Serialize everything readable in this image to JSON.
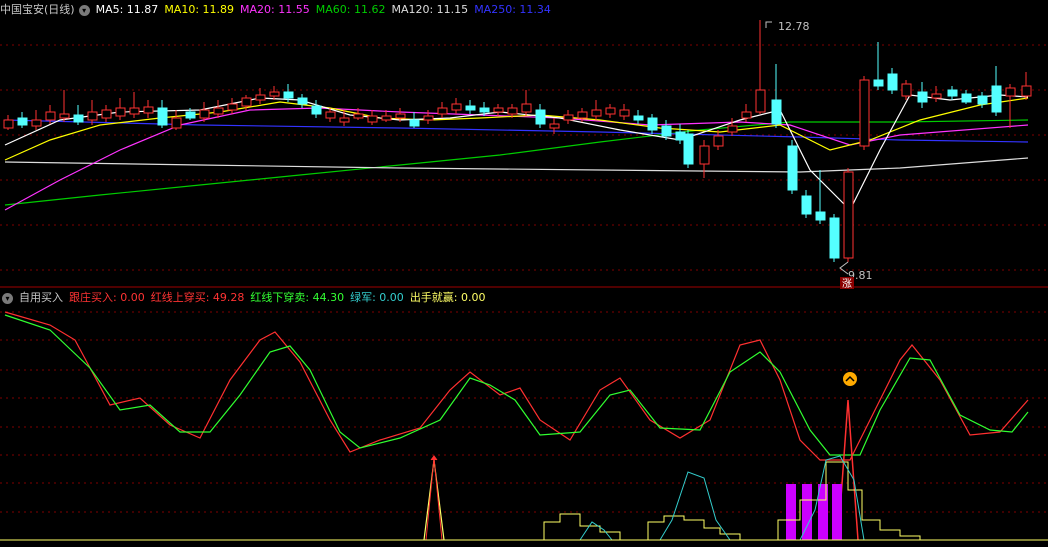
{
  "main_panel": {
    "title": "中国宝安(日线)",
    "ma": [
      {
        "label": "MA5: 11.87",
        "color": "#ffffff"
      },
      {
        "label": "MA10: 11.89",
        "color": "#ffff00"
      },
      {
        "label": "MA20: 11.55",
        "color": "#ff33ff"
      },
      {
        "label": "MA60: 11.62",
        "color": "#00cc00"
      },
      {
        "label": "MA120: 11.15",
        "color": "#dddddd"
      },
      {
        "label": "MA250: 11.34",
        "color": "#3333ff"
      }
    ],
    "high_label": "12.78",
    "low_label": "9.81",
    "limit_badge": "涨"
  },
  "indicator_panel": {
    "name": "自用买入",
    "items": [
      {
        "label": "跟庄买入: 0.00",
        "color": "#ff3333"
      },
      {
        "label": "红线上穿买: 49.28",
        "color": "#ff3333"
      },
      {
        "label": "红线下穿卖: 44.30",
        "color": "#33ff33"
      },
      {
        "label": "绿军: 0.00",
        "color": "#33cccc"
      },
      {
        "label": "出手就赢: 0.00",
        "color": "#ffff66"
      }
    ]
  },
  "colors": {
    "up": "#ff3232",
    "down": "#54ffff",
    "grid": "#7f0000",
    "background": "#000000"
  }
}
